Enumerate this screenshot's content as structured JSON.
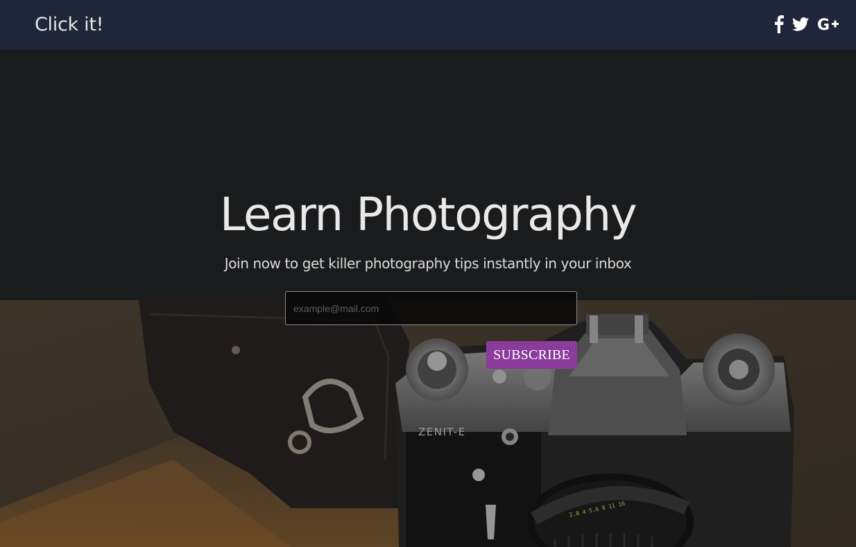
{
  "brand": "Click it!",
  "social": [
    {
      "icon": "facebook-icon",
      "glyph": "f"
    },
    {
      "icon": "twitter-icon",
      "glyph": "bird"
    },
    {
      "icon": "google-plus-icon",
      "glyph": "G+"
    }
  ],
  "hero": {
    "title": "Learn Photography",
    "subtitle": "Join now to get killer photography tips instantly in your inbox"
  },
  "form": {
    "email_placeholder": "example@mail.com",
    "subscribe_label": "SUBSCRIBE"
  },
  "photo": {
    "camera_brand": "ZENIT-E",
    "lens_scale": "2.8 4 5.6 8 11 16"
  },
  "colors": {
    "navbar": "#1f2639",
    "hero_background": "#1a1b1d",
    "subscribe_button": "#8b3c9a"
  }
}
